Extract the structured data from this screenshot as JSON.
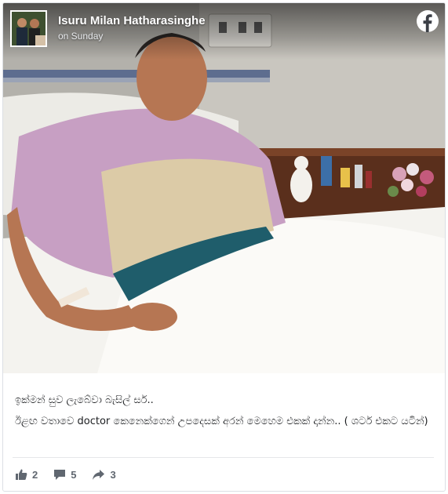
{
  "post": {
    "author_name": "Isuru Milan Hatharasinghe",
    "timestamp": "on Sunday",
    "caption_lines": [
      "ඉක්මන් සුව ලැබේවා බැසිල් සර්..",
      "ඊළඟ වතාවෙ doctor කෙනෙක්ගෙන් උපදෙසක් අරන් මෙහෙම එකක් දාන්න.. ( ශටර් එකට යටින්)"
    ]
  },
  "reactions": {
    "likes": "2",
    "comments": "5",
    "shares": "3"
  },
  "icons": {
    "brand": "facebook-icon",
    "like": "thumbs-up-icon",
    "comment": "comment-icon",
    "share": "share-arrow-icon"
  },
  "colors": {
    "brand": "#1877f2",
    "text": "#1c1e21",
    "action_text": "#606770"
  }
}
